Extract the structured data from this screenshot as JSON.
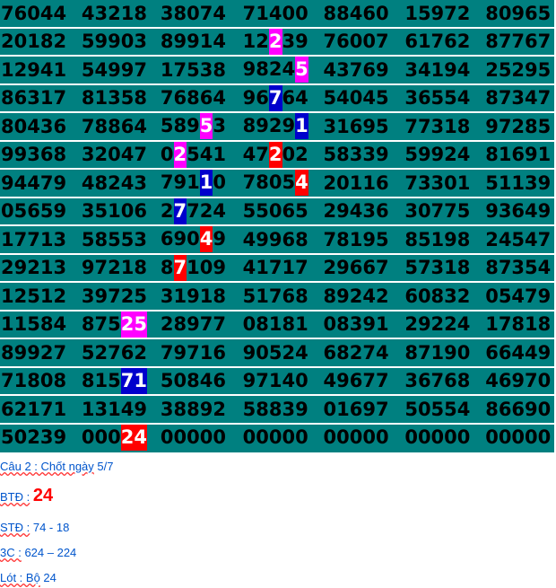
{
  "grid": {
    "rows": [
      [
        {
          "t": "76044"
        },
        {
          "t": "43218"
        },
        {
          "t": "38074"
        },
        {
          "t": "71400"
        },
        {
          "t": "88460"
        },
        {
          "t": "15972"
        },
        {
          "t": "80965"
        }
      ],
      [
        {
          "t": "20182"
        },
        {
          "t": "59903"
        },
        {
          "t": "89914"
        },
        {
          "t": "12239",
          "hs": 2,
          "hl": 1,
          "c": "magenta"
        },
        {
          "t": "76007"
        },
        {
          "t": "61762"
        },
        {
          "t": "87767"
        }
      ],
      [
        {
          "t": "12941"
        },
        {
          "t": "54997"
        },
        {
          "t": "17538"
        },
        {
          "t": "98245",
          "hs": 4,
          "hl": 1,
          "c": "magenta"
        },
        {
          "t": "43769"
        },
        {
          "t": "34194"
        },
        {
          "t": "25295"
        }
      ],
      [
        {
          "t": "86317"
        },
        {
          "t": "81358"
        },
        {
          "t": "76864"
        },
        {
          "t": "96764",
          "hs": 2,
          "hl": 1,
          "c": "blue"
        },
        {
          "t": "54045"
        },
        {
          "t": "36554"
        },
        {
          "t": "87347"
        }
      ],
      [
        {
          "t": "80436"
        },
        {
          "t": "78864"
        },
        {
          "t": "58953",
          "hs": 3,
          "hl": 1,
          "c": "magenta"
        },
        {
          "t": "89291",
          "hs": 4,
          "hl": 1,
          "c": "blue"
        },
        {
          "t": "31695"
        },
        {
          "t": "77318"
        },
        {
          "t": "97285"
        }
      ],
      [
        {
          "t": "99368"
        },
        {
          "t": "32047"
        },
        {
          "t": "02541",
          "hs": 1,
          "hl": 1,
          "c": "magenta"
        },
        {
          "t": "47202",
          "hs": 2,
          "hl": 1,
          "c": "red"
        },
        {
          "t": "58339"
        },
        {
          "t": "59924"
        },
        {
          "t": "81691"
        }
      ],
      [
        {
          "t": "94479"
        },
        {
          "t": "48243"
        },
        {
          "t": "79110",
          "hs": 3,
          "hl": 1,
          "c": "blue"
        },
        {
          "t": "78054",
          "hs": 4,
          "hl": 1,
          "c": "red"
        },
        {
          "t": "20116"
        },
        {
          "t": "73301"
        },
        {
          "t": "51139"
        }
      ],
      [
        {
          "t": "05659"
        },
        {
          "t": "35106"
        },
        {
          "t": "27724",
          "hs": 1,
          "hl": 1,
          "c": "blue"
        },
        {
          "t": "55065"
        },
        {
          "t": "29436"
        },
        {
          "t": "30775"
        },
        {
          "t": "93649"
        }
      ],
      [
        {
          "t": "17713"
        },
        {
          "t": "58553"
        },
        {
          "t": "69049",
          "hs": 3,
          "hl": 1,
          "c": "red"
        },
        {
          "t": "49968"
        },
        {
          "t": "78195"
        },
        {
          "t": "85198"
        },
        {
          "t": "24547"
        }
      ],
      [
        {
          "t": "29213"
        },
        {
          "t": "97218"
        },
        {
          "t": "87109",
          "hs": 1,
          "hl": 1,
          "c": "red"
        },
        {
          "t": "41717"
        },
        {
          "t": "29667"
        },
        {
          "t": "57318"
        },
        {
          "t": "87354"
        }
      ],
      [
        {
          "t": "12512"
        },
        {
          "t": "39725"
        },
        {
          "t": "31918"
        },
        {
          "t": "51768"
        },
        {
          "t": "89242"
        },
        {
          "t": "60832"
        },
        {
          "t": "05479"
        }
      ],
      [
        {
          "t": "11584"
        },
        {
          "t": "87525",
          "hs": 3,
          "hl": 2,
          "c": "magenta"
        },
        {
          "t": "28977"
        },
        {
          "t": "08181"
        },
        {
          "t": "08391"
        },
        {
          "t": "29224"
        },
        {
          "t": "17818"
        }
      ],
      [
        {
          "t": "89927"
        },
        {
          "t": "52762"
        },
        {
          "t": "79716"
        },
        {
          "t": "90524"
        },
        {
          "t": "68274"
        },
        {
          "t": "87190"
        },
        {
          "t": "66449"
        }
      ],
      [
        {
          "t": "71808"
        },
        {
          "t": "81571",
          "hs": 3,
          "hl": 2,
          "c": "blue"
        },
        {
          "t": "50846"
        },
        {
          "t": "97140"
        },
        {
          "t": "49677"
        },
        {
          "t": "36768"
        },
        {
          "t": "46970"
        }
      ],
      [
        {
          "t": "62171"
        },
        {
          "t": "13149"
        },
        {
          "t": "38892"
        },
        {
          "t": "58839"
        },
        {
          "t": "01697"
        },
        {
          "t": "50554"
        },
        {
          "t": "86690"
        }
      ],
      [
        {
          "t": "50239"
        },
        {
          "t": "00024",
          "hs": 3,
          "hl": 2,
          "c": "red"
        },
        {
          "t": "00000"
        },
        {
          "t": "00000"
        },
        {
          "t": "00000"
        },
        {
          "t": "00000"
        },
        {
          "t": "00000"
        }
      ]
    ]
  },
  "colors": {
    "background": "#008080",
    "magenta": "#ff00ff",
    "blue": "#0000cc",
    "red": "#ff0000"
  },
  "notes": {
    "line1": {
      "label": "Câu 2 : Chốt ngày",
      "value": " 5/7"
    },
    "line2": {
      "label": "BTĐ :",
      "value": "24"
    },
    "line3": {
      "label": "STĐ :",
      "value": " 74 - 18"
    },
    "line4": {
      "label": "3C :",
      "value": " 624  – 224"
    },
    "line5": {
      "label": "Lót : Bộ",
      "value": " 24"
    }
  }
}
